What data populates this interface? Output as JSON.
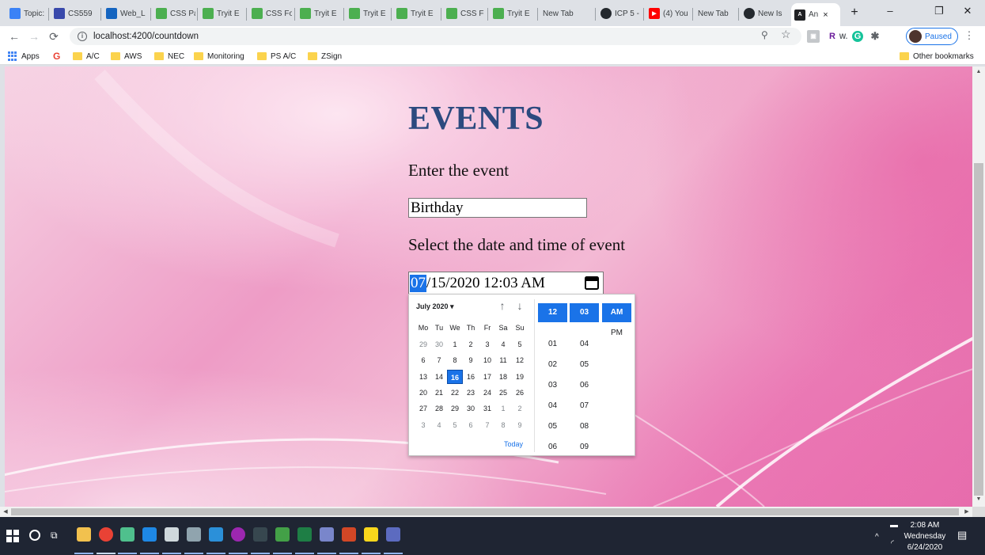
{
  "browser": {
    "tabs": [
      {
        "label": "Topic:",
        "favicon": "w3",
        "color": "#3b82f6"
      },
      {
        "label": "CS559",
        "favicon": "list",
        "color": "#3949ab"
      },
      {
        "label": "Web_L",
        "favicon": "box",
        "color": "#1565c0"
      },
      {
        "label": "CSS Pa",
        "favicon": "w3",
        "color": "#4caf50"
      },
      {
        "label": "Tryit E",
        "favicon": "w3",
        "color": "#4caf50"
      },
      {
        "label": "CSS Fo",
        "favicon": "w3",
        "color": "#4caf50"
      },
      {
        "label": "Tryit E",
        "favicon": "w3",
        "color": "#4caf50"
      },
      {
        "label": "Tryit E",
        "favicon": "w3",
        "color": "#4caf50"
      },
      {
        "label": "Tryit E",
        "favicon": "w3",
        "color": "#4caf50"
      },
      {
        "label": "CSS Fo",
        "favicon": "w3",
        "color": "#4caf50"
      },
      {
        "label": "Tryit E",
        "favicon": "w3",
        "color": "#4caf50"
      },
      {
        "label": "New Tab",
        "favicon": "",
        "color": ""
      },
      {
        "label": "ICP 5 -",
        "favicon": "github",
        "color": "#24292e"
      },
      {
        "label": "(4) You",
        "favicon": "youtube",
        "color": "#ff0000"
      },
      {
        "label": "New Tab",
        "favicon": "",
        "color": ""
      },
      {
        "label": "New Is",
        "favicon": "github",
        "color": "#24292e"
      },
      {
        "label": "An",
        "favicon": "angular",
        "color": "#202124"
      }
    ],
    "active_tab_close": "×",
    "new_tab": "+",
    "window_controls": {
      "minimize": "–",
      "restore": "❐",
      "close": "✕"
    },
    "url": "localhost:4200/countdown",
    "paused_label": "Paused",
    "bookmarks": [
      {
        "label": "Apps",
        "type": "apps"
      },
      {
        "label": "",
        "type": "google"
      },
      {
        "label": "A/C",
        "type": "folder"
      },
      {
        "label": "AWS",
        "type": "folder"
      },
      {
        "label": "NEC",
        "type": "folder"
      },
      {
        "label": "Monitoring",
        "type": "folder"
      },
      {
        "label": "PS A/C",
        "type": "folder"
      },
      {
        "label": "ZSign",
        "type": "folder"
      }
    ],
    "other_bookmarks": "Other bookmarks",
    "extensions": [
      {
        "label": "R",
        "color": "#6a1b9a"
      },
      {
        "label": "W.",
        "color": "#5f6368"
      },
      {
        "label": "G",
        "color": "#15c39a"
      }
    ]
  },
  "page": {
    "title": "EVENTS",
    "event_label": "Enter the event",
    "event_value": "Birthday",
    "date_label": "Select the date and time of event",
    "datetime": {
      "month": "07",
      "rest": "/15/2020 12:03 AM"
    }
  },
  "picker": {
    "month_label": "July 2020 ▾",
    "prev": "↑",
    "next": "↓",
    "weekdays": [
      "Mo",
      "Tu",
      "We",
      "Th",
      "Fr",
      "Sa",
      "Su"
    ],
    "weeks": [
      [
        {
          "d": "29",
          "dim": true
        },
        {
          "d": "30",
          "dim": true
        },
        {
          "d": "1"
        },
        {
          "d": "2"
        },
        {
          "d": "3"
        },
        {
          "d": "4"
        },
        {
          "d": "5"
        }
      ],
      [
        {
          "d": "6"
        },
        {
          "d": "7"
        },
        {
          "d": "8"
        },
        {
          "d": "9"
        },
        {
          "d": "10"
        },
        {
          "d": "11"
        },
        {
          "d": "12"
        }
      ],
      [
        {
          "d": "13"
        },
        {
          "d": "14"
        },
        {
          "d": "15",
          "sel": true
        },
        {
          "d": "16"
        },
        {
          "d": "17"
        },
        {
          "d": "18"
        },
        {
          "d": "19"
        }
      ],
      [
        {
          "d": "20"
        },
        {
          "d": "21"
        },
        {
          "d": "22"
        },
        {
          "d": "23"
        },
        {
          "d": "24"
        },
        {
          "d": "25"
        },
        {
          "d": "26"
        }
      ],
      [
        {
          "d": "27"
        },
        {
          "d": "28"
        },
        {
          "d": "29"
        },
        {
          "d": "30"
        },
        {
          "d": "31"
        },
        {
          "d": "1",
          "dim": true
        },
        {
          "d": "2",
          "dim": true
        }
      ],
      [
        {
          "d": "3",
          "dim": true
        },
        {
          "d": "4",
          "dim": true
        },
        {
          "d": "5",
          "dim": true
        },
        {
          "d": "6",
          "dim": true
        },
        {
          "d": "7",
          "dim": true
        },
        {
          "d": "8",
          "dim": true
        },
        {
          "d": "9",
          "dim": true
        }
      ]
    ],
    "selected_display": "16",
    "today_label": "Today",
    "hours": [
      "12",
      "01",
      "02",
      "03",
      "04",
      "05",
      "06"
    ],
    "minutes": [
      "03",
      "04",
      "05",
      "06",
      "07",
      "08",
      "09"
    ],
    "meridiem": [
      "AM",
      "PM"
    ]
  },
  "taskbar": {
    "time": "2:08 AM",
    "day": "Wednesday",
    "date": "6/24/2020",
    "apps": [
      {
        "name": "file-explorer",
        "color": "#f2c14e"
      },
      {
        "name": "chrome",
        "color": "#e94235"
      },
      {
        "name": "git",
        "color": "#4fc08d"
      },
      {
        "name": "edge",
        "color": "#1e88e5"
      },
      {
        "name": "settings",
        "color": "#cfd8dc"
      },
      {
        "name": "camera",
        "color": "#90a4ae"
      },
      {
        "name": "vscode",
        "color": "#2b90d9"
      },
      {
        "name": "media",
        "color": "#9c27b0"
      },
      {
        "name": "terminal",
        "color": "#37474f"
      },
      {
        "name": "app-green",
        "color": "#43a047"
      },
      {
        "name": "excel",
        "color": "#1e7e45"
      },
      {
        "name": "app-cloud",
        "color": "#7986cb"
      },
      {
        "name": "powerpoint",
        "color": "#d24726"
      },
      {
        "name": "sticky-notes",
        "color": "#f9d71c"
      },
      {
        "name": "app-blue",
        "color": "#5c6bc0"
      }
    ]
  },
  "colors": {
    "accent": "#1a73e8",
    "title": "#2c4a7f",
    "background_pink": "#ee9cc6"
  }
}
